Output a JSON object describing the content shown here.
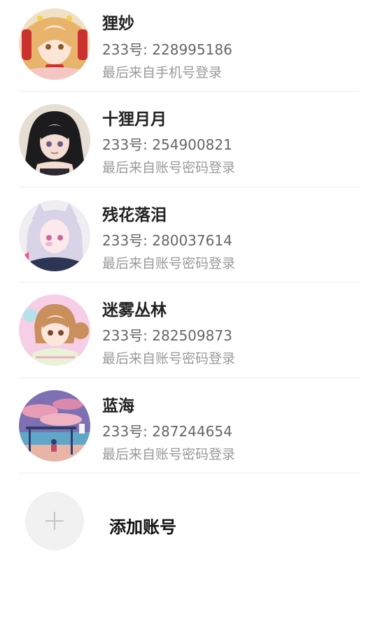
{
  "accounts": [
    {
      "name": "狸妙",
      "uid": "233号: 228995186",
      "login_source": "最后来自手机号登录",
      "avatar_icon": "anime-girl-blonde-avatar",
      "avatar_colors": [
        "#f3d9a5",
        "#e8b36a",
        "#c9322f"
      ]
    },
    {
      "name": "十狸月月",
      "uid": "233号: 254900821",
      "login_source": "最后来自账号密码登录",
      "avatar_icon": "anime-girl-dark-hair-avatar",
      "avatar_colors": [
        "#e6ded2",
        "#1c1c1f",
        "#f4ddd2"
      ]
    },
    {
      "name": "残花落泪",
      "uid": "233号: 280037614",
      "login_source": "最后来自账号密码登录",
      "avatar_icon": "anime-catgirl-silver-avatar",
      "avatar_colors": [
        "#f1eef3",
        "#d8d3e6",
        "#2d3554"
      ]
    },
    {
      "name": "迷雾丛林",
      "uid": "233号: 282509873",
      "login_source": "最后来自账号密码登录",
      "avatar_icon": "anime-girl-pastel-avatar",
      "avatar_colors": [
        "#f6cfe6",
        "#c98f5c",
        "#b6e3ea"
      ]
    },
    {
      "name": "蓝海",
      "uid": "233号: 287244654",
      "login_source": "最后来自账号密码登录",
      "avatar_icon": "sunset-beach-avatar",
      "avatar_colors": [
        "#7f6fb3",
        "#e79bb4",
        "#2f3d6b"
      ]
    }
  ],
  "add_account": {
    "label": "添加账号",
    "icon": "plus-icon"
  }
}
